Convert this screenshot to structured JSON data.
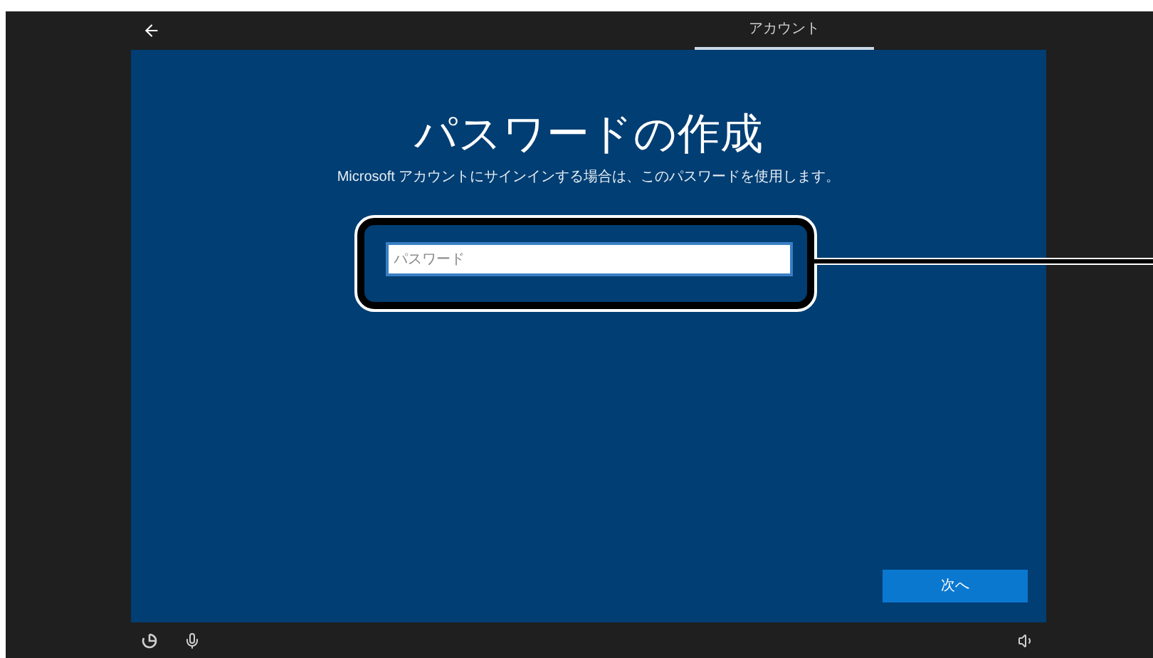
{
  "header": {
    "tab": {
      "label": "アカウント",
      "selected": true
    }
  },
  "panel": {
    "title": "パスワードの作成",
    "subtitle": "Microsoft アカウントにサインインする場合は、このパスワードを使用します。",
    "password_field": {
      "placeholder": "パスワード"
    },
    "next_button": "次へ"
  }
}
